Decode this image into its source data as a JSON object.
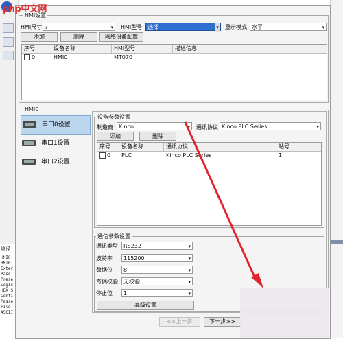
{
  "watermark": "php中文网",
  "hmi_settings": {
    "group_label": "HMI设置",
    "size_label": "HMI尺寸",
    "size_value": "7",
    "type_label": "HMI型号",
    "type_value": "选择",
    "display_mode_label": "显示模式",
    "display_mode_value": "水平",
    "add_label": "添加",
    "delete_label": "删除",
    "network_config_label": "网络设备配置",
    "columns": [
      "序号",
      "设备名称",
      "HMI型号",
      "描述信息"
    ],
    "rows": [
      {
        "index": "0",
        "name": "HMI0",
        "model": "MT070",
        "desc": ""
      }
    ]
  },
  "hmi0": {
    "group_label": "HMI0",
    "nav": [
      {
        "label": "串口0设置"
      },
      {
        "label": "串口1设置"
      },
      {
        "label": "串口2设置"
      }
    ]
  },
  "device_params": {
    "group_label": "设备参数设置",
    "manufacturer_label": "制造商",
    "manufacturer_value": "Kinco",
    "protocol_label": "通讯协议",
    "protocol_value": "Kinco PLC Series",
    "add_label": "添加",
    "delete_label": "删除",
    "columns": [
      "序号",
      "设备名称",
      "通讯协议",
      "站号"
    ],
    "rows": [
      {
        "index": "0",
        "name": "PLC",
        "protocol": "Kinco PLC Series",
        "station": "1"
      }
    ]
  },
  "comm_params": {
    "group_label": "通信参数设置",
    "fields": [
      {
        "label": "通讯类型",
        "value": "RS232"
      },
      {
        "label": "波特率",
        "value": "115200"
      },
      {
        "label": "数据位",
        "value": "8"
      },
      {
        "label": "奇偶校验",
        "value": "无校验"
      },
      {
        "label": "停止位",
        "value": "1"
      }
    ],
    "advanced_label": "高级设置"
  },
  "footer": {
    "prev_label": "<<上一步",
    "next_label": "下一步>>"
  },
  "left_strip": {
    "label": "编译",
    "lines": [
      "HMI0:",
      "HMI0:",
      "Exter",
      "Pass",
      "Prese",
      "Logic",
      "HEX S",
      "Confi",
      "Passe",
      "File",
      "ASCII"
    ]
  },
  "colors": {
    "selected_nav": "#bcd6ee",
    "selected_combo": "#2f6fd0",
    "arrow": "#e0242d"
  }
}
